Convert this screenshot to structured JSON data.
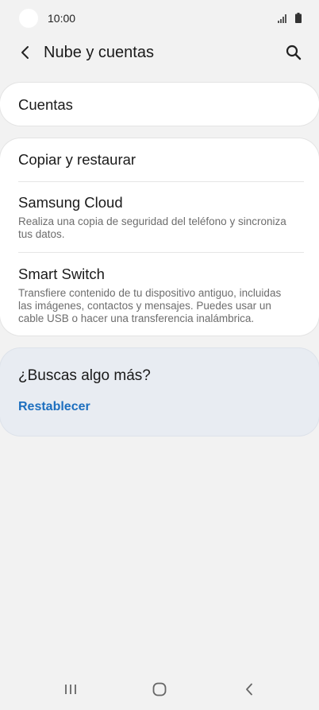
{
  "status_bar": {
    "time": "10:00"
  },
  "header": {
    "title": "Nube y cuentas",
    "icons": {
      "back": "back-arrow-icon",
      "search": "search-icon"
    }
  },
  "accounts_card": {
    "title": "Cuentas"
  },
  "backup_card": {
    "items": [
      {
        "title": "Copiar y restaurar",
        "subtitle": ""
      },
      {
        "title": "Samsung Cloud",
        "subtitle": "Realiza una copia de seguridad del teléfono y sincroniza tus datos."
      },
      {
        "title": "Smart Switch",
        "subtitle": "Transfiere contenido de tu dispositivo antiguo, incluidas las imágenes, contactos y mensajes. Puedes usar un cable USB o hacer una transferencia inalámbrica."
      }
    ]
  },
  "suggestions": {
    "title": "¿Buscas algo más?",
    "link": "Restablecer"
  },
  "nav_bar": {
    "icons": [
      "recents-icon",
      "home-icon",
      "back-icon"
    ]
  },
  "colors": {
    "background": "#f2f2f2",
    "card": "#ffffff",
    "suggest_card": "#e8ecf2",
    "link": "#1d6fbf",
    "secondary_text": "#6d6d6d"
  }
}
